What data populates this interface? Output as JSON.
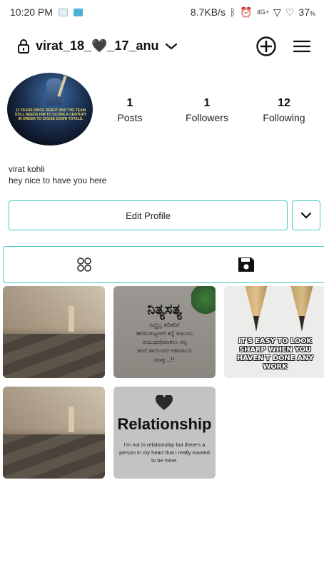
{
  "status_bar": {
    "time": "10:20 PM",
    "network_speed": "8.7KB/s",
    "network_type": "4G+",
    "battery": "37",
    "battery_unit": "%"
  },
  "header": {
    "username": "virat_18_🖤_17_anu",
    "icons": [
      "lock-icon",
      "chevron-down-icon",
      "add-circle-icon",
      "menu-icon"
    ]
  },
  "profile": {
    "avatar_caption": "11 YEARS SINCE DEBUT AND THE TEAM STILL NEEDS HIM TO SCORE A CENTURY IN ORDER TO CHASE DOWN TOTALS.",
    "stats": [
      {
        "value": "1",
        "label": "Posts"
      },
      {
        "value": "1",
        "label": "Followers"
      },
      {
        "value": "12",
        "label": "Following"
      }
    ],
    "name": "virat kohli",
    "bio": "hey nice to have you here"
  },
  "actions": {
    "edit_profile_label": "Edit Profile"
  },
  "tabs": [
    {
      "name": "grid",
      "icon": "grid-icon",
      "active": false
    },
    {
      "name": "saved",
      "icon": "save-icon",
      "active": true
    }
  ],
  "posts": [
    {
      "kind": "room"
    },
    {
      "kind": "kannada",
      "title": "ನಿತ್ಯಸತ್ಯ",
      "lines": [
        "ನಿಜ್ಜೈಲ್ಲ ಕಲಿತರಿಗೆ",
        "ಹರಮೋಜ್ಯವಾಗಿ ಕನ್ನೆ ಕುಟುಂಬ",
        "ಆಯುಧವೊರಂತಲು ನನ್ನ",
        "ತಂದೆ ತಾಯಿಯರ ಆಶೀರ್ವಾದ",
        "ಮಾತ್ರ...!!"
      ]
    },
    {
      "kind": "pencil",
      "quote": "IT'S EASY TO LOOK SHARP WHEN YOU HAVEN'T DONE ANY WORK"
    },
    {
      "kind": "room"
    },
    {
      "kind": "relationship",
      "title": "Relationship",
      "quote": "I'm not in relationship but there's a person in my heart that i really wanted to be mine."
    }
  ],
  "colors": {
    "accent": "#48c9c2",
    "text": "#111111",
    "background": "#ffffff"
  }
}
